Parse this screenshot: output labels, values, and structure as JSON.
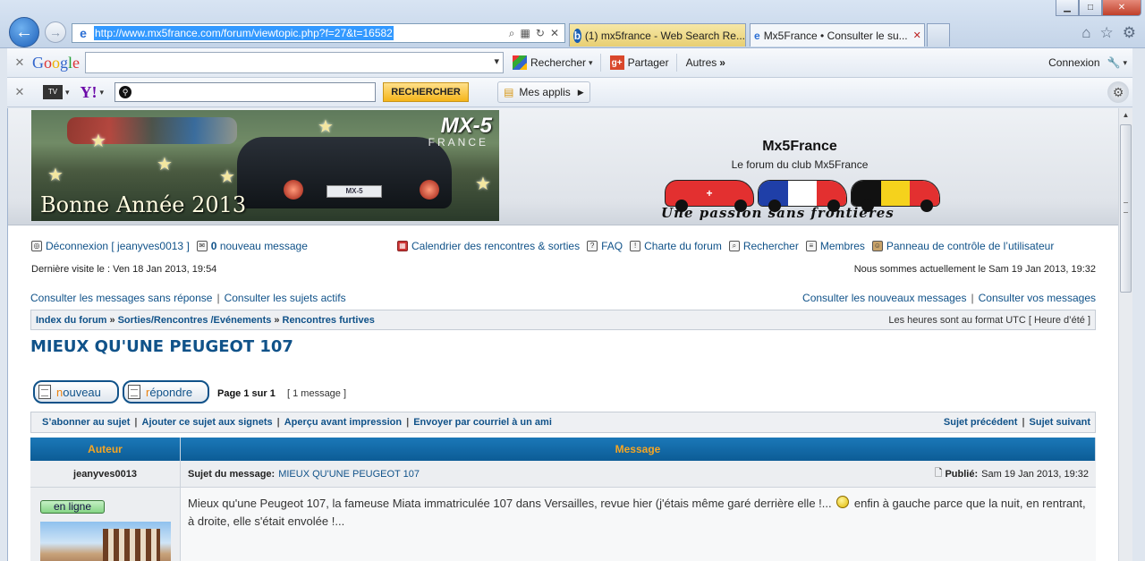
{
  "browser": {
    "url": "http://www.mx5france.com/forum/viewtopic.php?f=27&t=16582",
    "tabs": [
      {
        "label": "(1) mx5france - Web Search Re..."
      },
      {
        "label": "Mx5France • Consulter le su..."
      }
    ],
    "google_toolbar": {
      "logo": "Google",
      "search_label": "Rechercher",
      "share_label": "Partager",
      "more_label": "Autres",
      "login_label": "Connexion"
    },
    "yahoo_toolbar": {
      "search_button": "RECHERCHER",
      "apps_label": "Mes applis"
    }
  },
  "site": {
    "banner_text": "Bonne Année 2013",
    "banner_logo": "MX-5",
    "banner_logo_sub": "FRANCE",
    "plate_text": "MX-5",
    "title": "Mx5France",
    "description": "Le forum du club Mx5France",
    "slogan": "Une passion sans frontières"
  },
  "nav": {
    "logout": "Déconnexion [ jeanyves0013 ]",
    "new_msg_count": "0",
    "new_msg_label": "nouveau message",
    "calendar": "Calendrier des rencontres & sorties",
    "faq": "FAQ",
    "charter": "Charte du forum",
    "search": "Rechercher",
    "members": "Membres",
    "ucp": "Panneau de contrôle de l’utilisateur",
    "last_visit": "Dernière visite le : Ven 18 Jan 2013, 19:54",
    "current_time": "Nous sommes actuellement le Sam 19 Jan 2013, 19:32",
    "unanswered": "Consulter les messages sans réponse",
    "active": "Consulter les sujets actifs",
    "new_posts": "Consulter les nouveaux messages",
    "your_posts": "Consulter vos messages"
  },
  "breadcrumb": {
    "items": [
      "Index du forum",
      "Sorties/Rencontres /Evénements",
      "Rencontres furtives"
    ],
    "timezone": "Les heures sont au format UTC [ Heure d’été ]"
  },
  "topic": {
    "title": "MIEUX QU'UNE PEUGEOT 107",
    "new_btn_first": "n",
    "new_btn_rest": "ouveau",
    "reply_btn_first": "r",
    "reply_btn_rest": "épondre",
    "page_info": "Page 1 sur 1",
    "msg_count": "[ 1 message ]",
    "actions": {
      "subscribe": "S’abonner au sujet",
      "bookmark": "Ajouter ce sujet aux signets",
      "print": "Aperçu avant impression",
      "email": "Envoyer par courriel à un ami",
      "prev": "Sujet précédent",
      "next": "Sujet suivant"
    }
  },
  "post_table": {
    "col_author": "Auteur",
    "col_message": "Message",
    "author": "jeanyves0013",
    "subject_label": "Sujet du message:",
    "subject": "MIEUX QU'UNE PEUGEOT 107",
    "published_label": "Publié:",
    "published": "Sam 19 Jan 2013, 19:32",
    "online": "en ligne",
    "body_part1": "Mieux qu'une Peugeot 107, la fameuse Miata immatriculée 107 dans Versailles, revue hier (j'étais même garé derrière elle !...",
    "body_part2": "enfin à gauche parce que la nuit, en rentrant, à droite, elle s'était envolée !..."
  },
  "colors": {
    "link": "#105289",
    "header_bar": "#1b78b8",
    "header_text": "#f6a623",
    "accent_letter": "#e98210"
  }
}
